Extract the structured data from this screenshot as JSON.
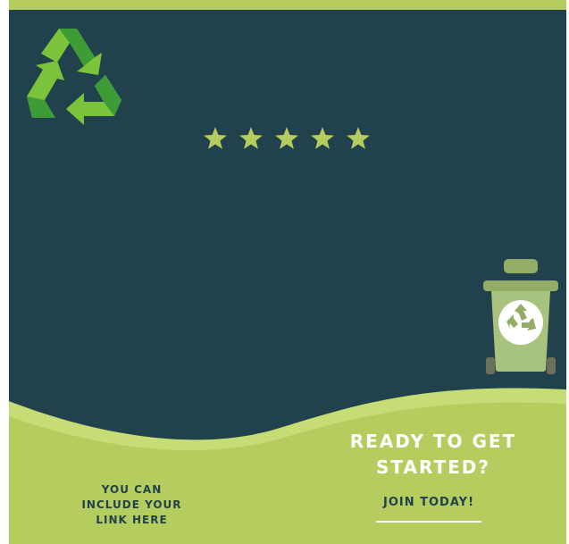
{
  "colors": {
    "background": "#21424c",
    "accent": "#b5cd5e",
    "accent_light": "#c6dc74",
    "logo_dark_green": "#3d9c35",
    "logo_light_green": "#7bc33a",
    "star": "#b5cd5e",
    "bin_body": "#a7c37e",
    "text_light": "#ffffff",
    "text_dark": "#21424c"
  },
  "logo": {
    "icon": "recycle-icon"
  },
  "rating": {
    "stars": 5,
    "max": 5
  },
  "bin": {
    "icon": "recycle-bin-icon"
  },
  "cta": {
    "title": "READY TO GET\nSTARTED?",
    "button_label": "JOIN TODAY!"
  },
  "link_note": {
    "text": "YOU CAN\nINCLUDE YOUR\nLINK HERE"
  }
}
